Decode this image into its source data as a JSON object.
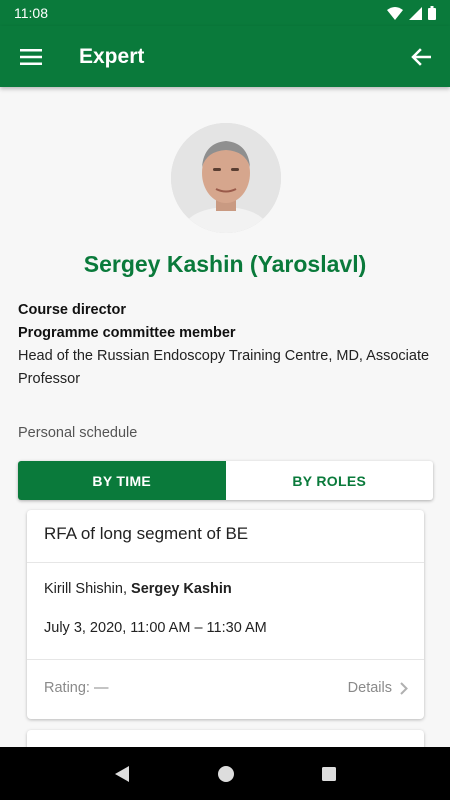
{
  "status_bar": {
    "time": "11:08"
  },
  "app_bar": {
    "title": "Expert"
  },
  "expert": {
    "name": "Sergey Kashin (Yaroslavl)",
    "role1": "Course director",
    "role2": "Programme committee member",
    "description": "Head of the Russian Endoscopy Training Centre, MD, Associate Professor"
  },
  "schedule": {
    "label": "Personal schedule",
    "tabs": {
      "by_time": "BY TIME",
      "by_roles": "BY ROLES"
    },
    "selected_tab": "BY TIME"
  },
  "sessions": [
    {
      "title": "RFA of long segment of BE",
      "speaker_other": "Kirill Shishin, ",
      "speaker_self": "Sergey Kashin",
      "datetime": "July 3, 2020, 11:00 AM – 11:30 AM",
      "rating": "Rating: —",
      "details": "Details"
    }
  ],
  "colors": {
    "primary": "#0a7a3b",
    "background": "#f7f7f7"
  },
  "icons": [
    "menu-icon",
    "back-arrow-icon",
    "wifi-icon",
    "signal-icon",
    "battery-icon",
    "chevron-right-icon",
    "nav-back-icon",
    "nav-home-icon",
    "nav-recents-icon"
  ]
}
